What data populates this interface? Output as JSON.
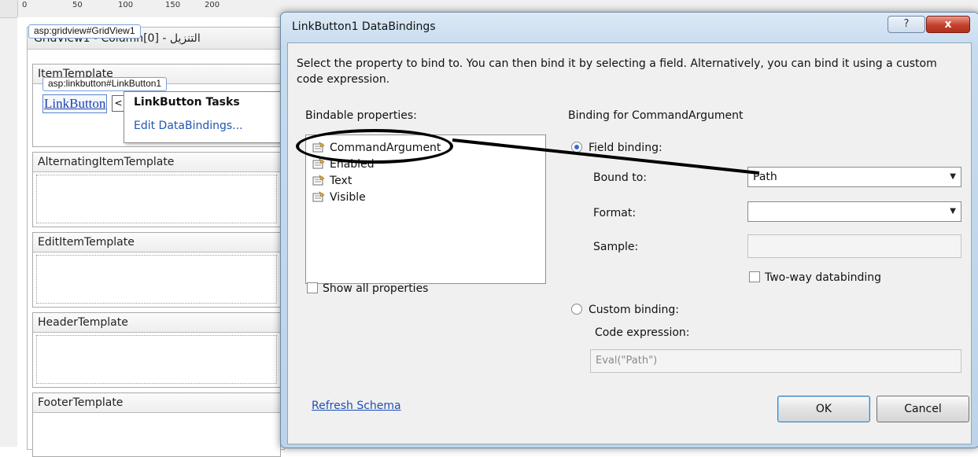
{
  "designer": {
    "ruler_top_numbers": [
      "0",
      "50",
      "100",
      "150",
      "200"
    ],
    "gridview_tag": "asp:gridview#GridView1",
    "gridview_title": "GridView1 - Column[0] - التنزيل",
    "item_template": {
      "header": "ItemTemplate",
      "linkbutton_tag": "asp:linkbutton#LinkButton1",
      "linkbutton_text": "LinkButton",
      "smart_tag_arrow": "<"
    },
    "tasks_panel": {
      "title": "LinkButton Tasks",
      "link": "Edit DataBindings..."
    },
    "templates": [
      "AlternatingItemTemplate",
      "EditItemTemplate",
      "HeaderTemplate",
      "FooterTemplate"
    ]
  },
  "dialog": {
    "title": "LinkButton1 DataBindings",
    "help_glyph": "?",
    "close_glyph": "x",
    "instructions": "Select the property to bind to. You can then bind it by selecting a field. Alternatively, you can bind it using a custom code expression.",
    "bindable_label": "Bindable properties:",
    "properties": [
      "CommandArgument",
      "Enabled",
      "Text",
      "Visible"
    ],
    "show_all_label": "Show all properties",
    "refresh_link": "Refresh Schema",
    "binding_for_label": "Binding for CommandArgument",
    "field_binding_label": "Field binding:",
    "bound_to_label": "Bound to:",
    "bound_to_value": "Path",
    "format_label": "Format:",
    "format_value": "",
    "sample_label": "Sample:",
    "twoway_label": "Two-way databinding",
    "custom_binding_label": "Custom binding:",
    "code_expression_label": "Code expression:",
    "code_expression_value": "Eval(\"Path\")",
    "ok_label": "OK",
    "cancel_label": "Cancel"
  },
  "colors": {
    "link_blue": "#1e4fb8",
    "title_bar": "#c7dbef",
    "close_red": "#c4402b",
    "annotation": "#000000"
  }
}
